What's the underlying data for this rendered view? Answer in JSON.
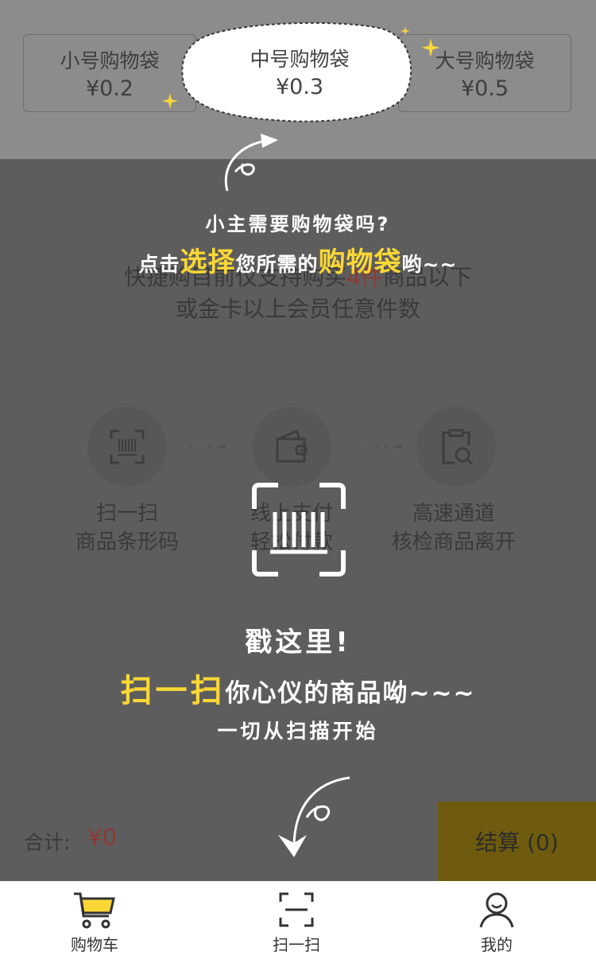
{
  "bags": [
    {
      "name": "小号购物袋",
      "price": "¥0.2"
    },
    {
      "name": "中号购物袋",
      "price": "¥0.3"
    },
    {
      "name": "大号购物袋",
      "price": "¥0.5"
    }
  ],
  "notice": {
    "line1_prefix": "快捷购目前仅支持购买",
    "line1_highlight": "4件",
    "line1_suffix": "商品以下",
    "line2": "或金卡以上会员任意件数"
  },
  "steps": [
    {
      "icon": "barcode-scan-icon",
      "line1": "扫一扫",
      "line2": "商品条形码"
    },
    {
      "icon": "wallet-icon",
      "line1": "线上支付",
      "line2": "轻松付款"
    },
    {
      "icon": "clipboard-search-icon",
      "line1": "高速通道",
      "line2": "核检商品离开"
    }
  ],
  "step_arrow": "- - - →",
  "footer": {
    "total_label": "合计:",
    "total_value": "¥0",
    "checkout_label": "结算 (0)"
  },
  "tabs": [
    {
      "label": "购物车",
      "icon": "cart-icon",
      "active": true
    },
    {
      "label": "扫一扫",
      "icon": "scan-icon",
      "active": false
    },
    {
      "label": "我的",
      "icon": "user-icon",
      "active": false
    }
  ],
  "guide": {
    "bag_question": "小主需要购物袋吗?",
    "bag_tip_prefix": "点击",
    "bag_tip_h1": "选择",
    "bag_tip_mid": "您所需的",
    "bag_tip_h2": "购物袋",
    "bag_tip_suffix": "哟~~",
    "scan_title": "戳这里!",
    "scan_tip_highlight": "扫一扫",
    "scan_tip_rest": "你心仪的商品呦~~~",
    "scan_sub": "一切从扫描开始"
  },
  "colors": {
    "accent_yellow": "#fbd735",
    "price_red": "#8d3a33",
    "checkout_bg": "#6e5b0d",
    "overlay_gray": "#5d5d5d"
  }
}
